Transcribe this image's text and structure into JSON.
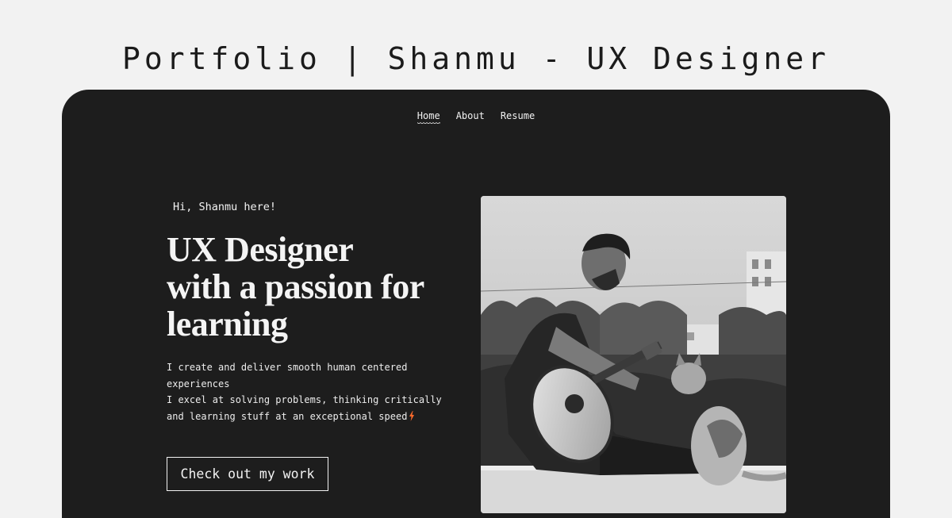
{
  "page_title": "Portfolio | Shanmu - UX Designer",
  "nav": {
    "items": [
      {
        "label": "Home",
        "active": true
      },
      {
        "label": "About",
        "active": false
      },
      {
        "label": "Resume",
        "active": false
      }
    ]
  },
  "hero": {
    "greeting": "Hi, Shanmu here!",
    "headline_lines": [
      "UX Designer",
      "with a passion for",
      "learning"
    ],
    "bio_line1": "I create and deliver smooth human centered experiences",
    "bio_line2": "I excel at solving problems, thinking critically and learning stuff at an exceptional speed",
    "cta_label": "Check out my work"
  },
  "colors": {
    "page_background": "#f2f2f2",
    "card_background": "#1d1d1d",
    "text_light": "#f2f2f2",
    "accent_bolt": "#ff6a2b"
  },
  "icons": {
    "bio_bolt": "lightning-bolt-icon"
  },
  "photo": {
    "style": "black-and-white"
  }
}
